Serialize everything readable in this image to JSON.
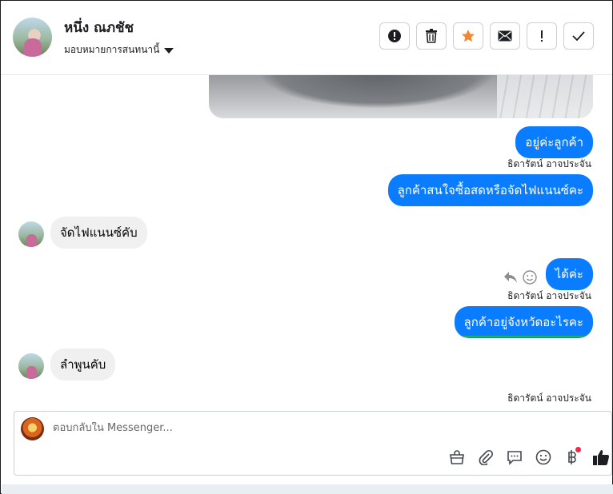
{
  "header": {
    "contact_name": "หนึ่ง ณภชัช",
    "assign_label": "มอบหมายการสนทนานี้",
    "toolbar_icons": [
      "alert-circle-icon",
      "trash-icon",
      "star-icon",
      "envelope-icon",
      "exclamation-icon",
      "check-icon"
    ],
    "star_color": "#f5862e"
  },
  "messages": [
    {
      "type": "image",
      "direction": "out"
    },
    {
      "direction": "out",
      "text": "อยู่ค่ะลูกค้า",
      "sender": "ธิดารัตน์ อาจประจัน"
    },
    {
      "direction": "out",
      "text": "ลูกค้าสนใจซื้อสดหรือจัดไฟแนนซ์คะ"
    },
    {
      "direction": "in",
      "text": "จัดไฟแนนซ์คับ"
    },
    {
      "direction": "out",
      "text": "ได้ค่ะ",
      "sender": "ธิดารัตน์ อาจประจัน"
    },
    {
      "direction": "out",
      "text": "ลูกค้าอยู่จังหวัดอะไรคะ"
    },
    {
      "direction": "in",
      "text": "ลำพูนคับ"
    },
    {
      "direction": "out",
      "sender": "ธิดารัตน์ อาจประจัน"
    }
  ],
  "composer": {
    "placeholder": "ตอบกลับใน Messenger...",
    "tool_icons": [
      "bag-icon",
      "paperclip-icon",
      "speech-bubble-icon",
      "emoji-icon",
      "baht-icon",
      "thumbs-up-icon"
    ]
  },
  "colors": {
    "outgoing_bubble": "#0a7cff",
    "incoming_bubble": "#f0f0f0",
    "notification_dot": "#f02849"
  }
}
